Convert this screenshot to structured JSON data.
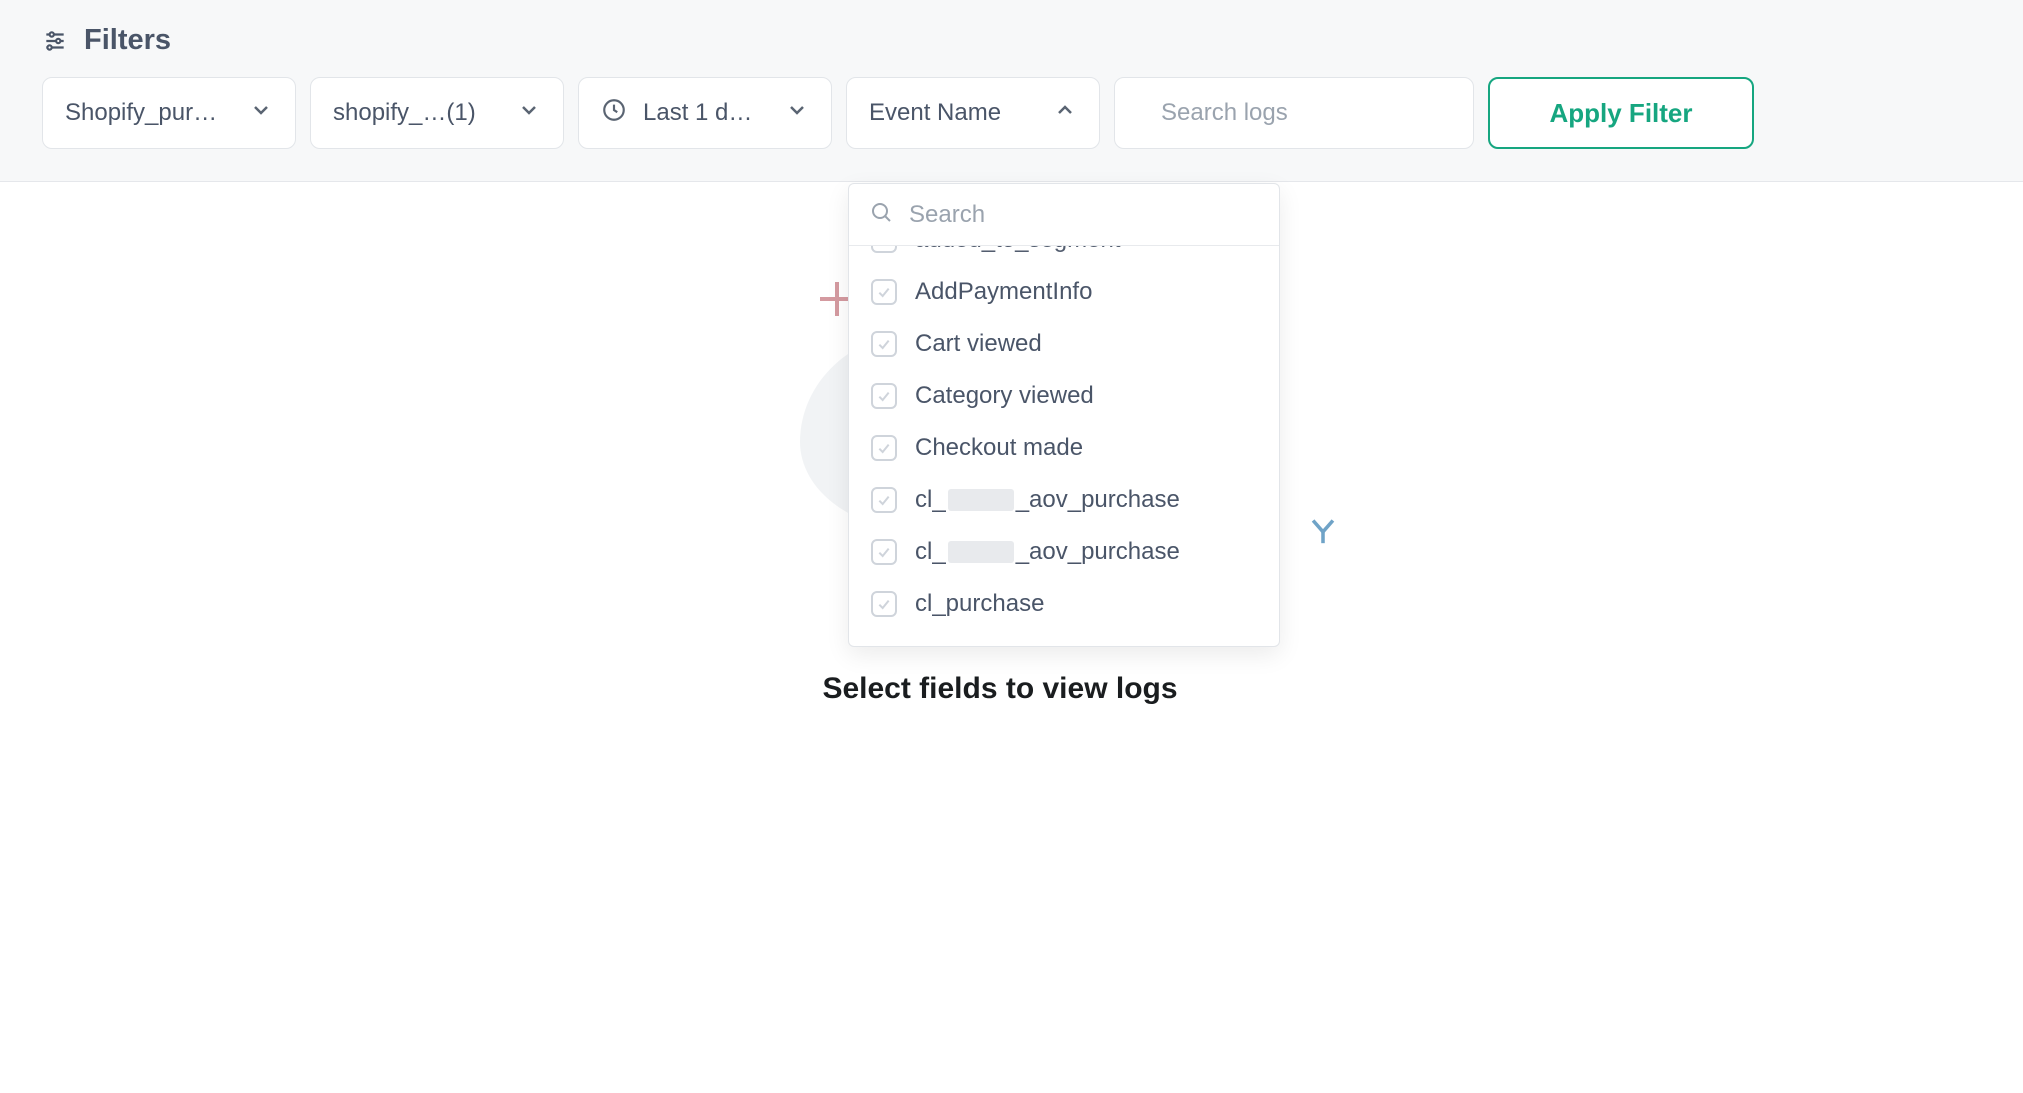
{
  "filters": {
    "title": "Filters",
    "dropdown1": "Shopify_pur…",
    "dropdown2": "shopify_…(1)",
    "dropdown3": "Last 1 d…",
    "dropdown4": "Event Name",
    "search_placeholder": "Search logs",
    "apply_label": "Apply Filter"
  },
  "event_dropdown": {
    "search_placeholder": "Search",
    "items": [
      {
        "label_parts": [
          "added_to_segment"
        ],
        "cutoff": true
      },
      {
        "label_parts": [
          "AddPaymentInfo"
        ]
      },
      {
        "label_parts": [
          "Cart viewed"
        ]
      },
      {
        "label_parts": [
          "Category viewed"
        ]
      },
      {
        "label_parts": [
          "Checkout made"
        ]
      },
      {
        "label_parts": [
          "cl_",
          "__REDACT__",
          "_aov_purchase"
        ]
      },
      {
        "label_parts": [
          "cl_",
          "__REDACT__",
          "_aov_purchase"
        ]
      },
      {
        "label_parts": [
          "cl_purchase"
        ]
      }
    ]
  },
  "empty_state": {
    "text": "Select fields to view logs"
  }
}
